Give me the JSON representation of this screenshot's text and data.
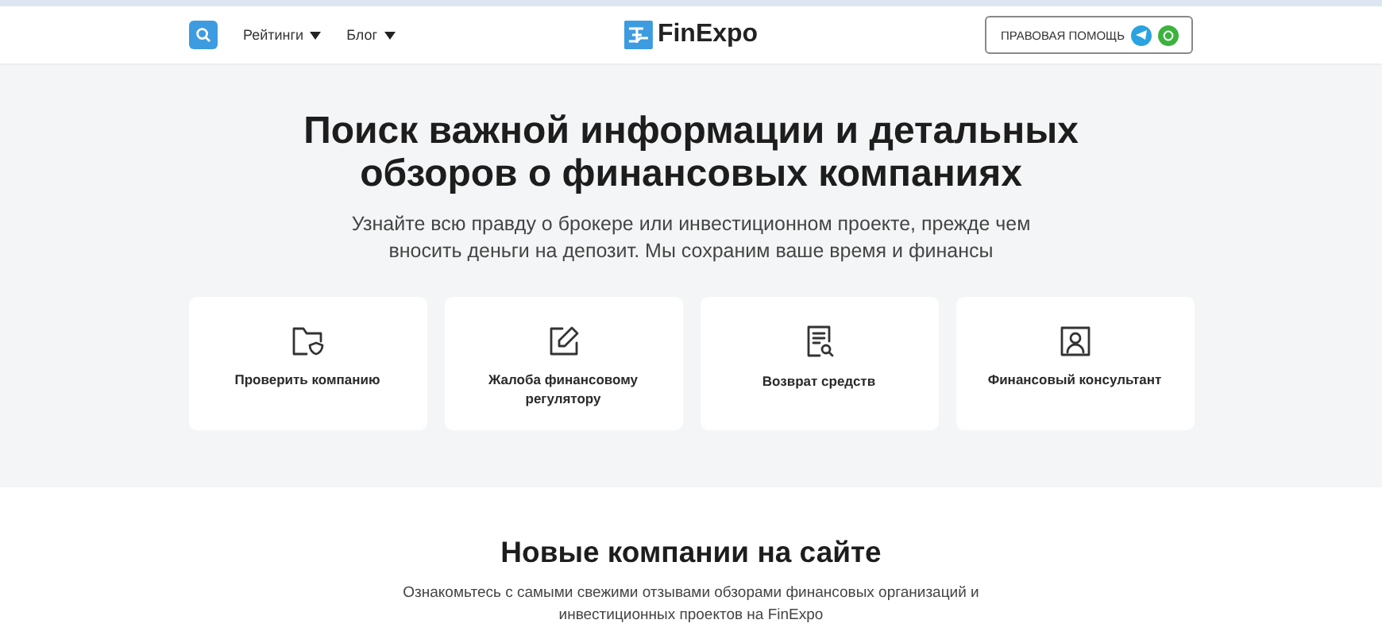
{
  "header": {
    "nav": [
      {
        "label": "Рейтинги"
      },
      {
        "label": "Блог"
      }
    ],
    "logo": "FinExpo",
    "help_button": "ПРАВОВАЯ ПОМОЩЬ"
  },
  "hero": {
    "title": "Поиск важной информации и детальных обзоров о финансовых компаниях",
    "subtitle": "Узнайте всю правду о брокере или инвестиционном проекте, прежде чем вносить деньги на депозит. Мы сохраним ваше время и финансы",
    "cards": [
      {
        "label": "Проверить компанию"
      },
      {
        "label": "Жалоба финансовому регулятору"
      },
      {
        "label": "Возврат средств"
      },
      {
        "label": "Финансовый консультант"
      }
    ]
  },
  "new_companies": {
    "title": "Новые компании на сайте",
    "text": "Ознакомьтесь с самыми свежими отзывами обзорами финансовых организаций и инвестиционных проектов на FinExpo"
  }
}
